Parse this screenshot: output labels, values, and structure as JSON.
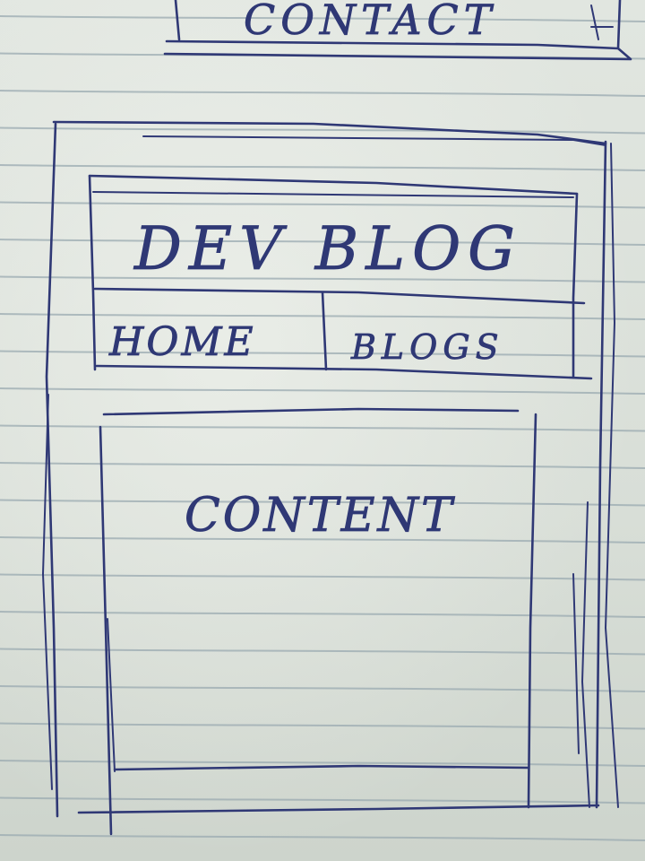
{
  "sketch": {
    "top_link": "CONTACT",
    "header_title": "DEV BLOG",
    "nav_items": [
      "HOME",
      "BLOGS"
    ],
    "content_label": "CONTENT"
  },
  "colors": {
    "paper": "#dde3dc",
    "ruled_line": "#9aa9b0",
    "ink": "#2f3875"
  }
}
